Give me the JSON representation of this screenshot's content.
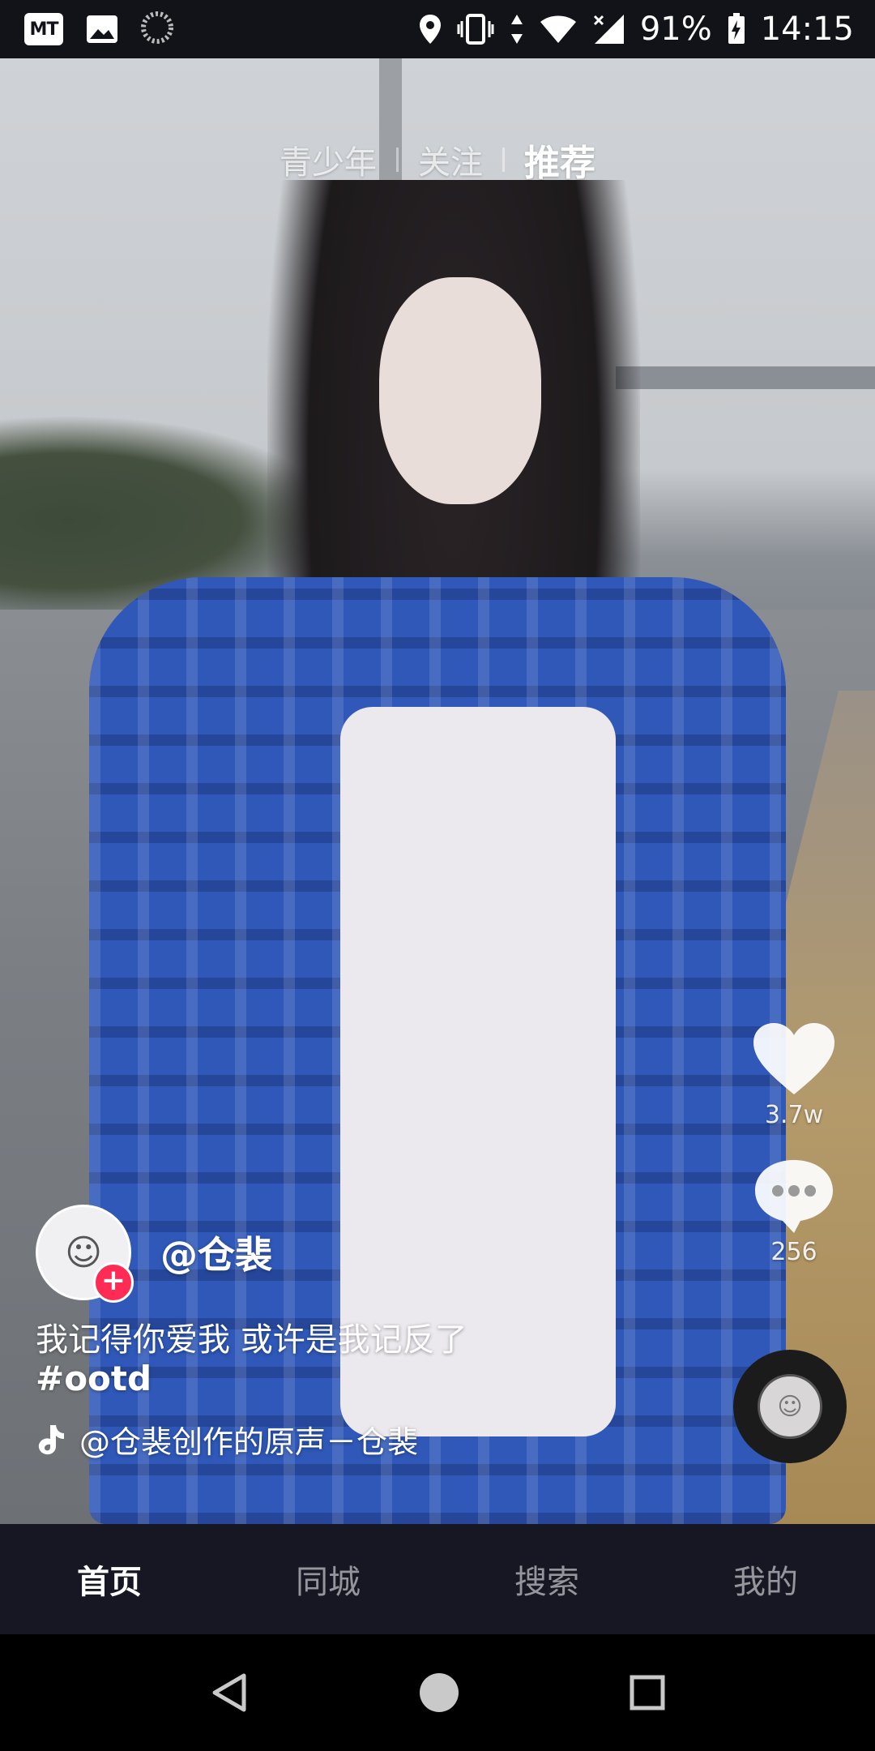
{
  "status_bar": {
    "app_icons": [
      "mt-app-icon",
      "gallery-icon",
      "loading-icon"
    ],
    "mt_label": "MT",
    "battery": "91%",
    "time": "14:15"
  },
  "top_tabs": [
    {
      "label": "青少年",
      "active": false
    },
    {
      "label": "关注",
      "active": false
    },
    {
      "label": "推荐",
      "active": true
    }
  ],
  "actions": {
    "like_count": "3.7w",
    "comment_count": "256"
  },
  "video_info": {
    "author": "@仓裴",
    "caption": "我记得你爱我 或许是我记反了",
    "hashtag": "#ootd",
    "music": "@仓裴创作的原声－仓裴",
    "follow_symbol": "+"
  },
  "bottom_nav": [
    {
      "label": "首页",
      "active": true
    },
    {
      "label": "同城",
      "active": false
    },
    {
      "label": "搜索",
      "active": false
    },
    {
      "label": "我的",
      "active": false
    }
  ],
  "colors": {
    "status_bar_bg": "#121219",
    "bottom_nav_bg": "#161722",
    "follow_accent": "#fe2c55"
  }
}
